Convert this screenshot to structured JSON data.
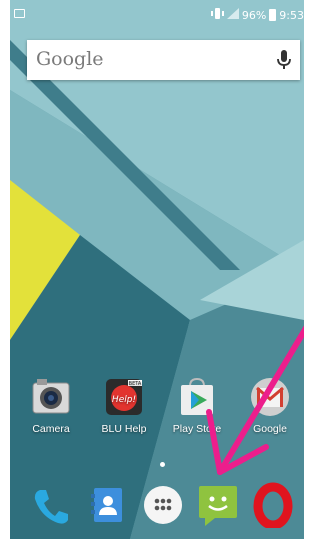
{
  "status_bar": {
    "battery": "96%",
    "time": "9:53",
    "icons": [
      "screenshot-icon",
      "vibrate-icon",
      "signal-icon",
      "battery-icon"
    ]
  },
  "search_widget": {
    "logo_text": "Google",
    "icon": "mic-icon"
  },
  "apps": [
    {
      "label": "Camera",
      "icon": "camera-icon"
    },
    {
      "label": "BLU Help",
      "icon": "blu-help-icon",
      "icon_text": "Help!",
      "badge": "BETA"
    },
    {
      "label": "Play Store",
      "icon": "play-store-icon"
    },
    {
      "label": "Google",
      "icon": "gmail-icon"
    }
  ],
  "dock": [
    {
      "name": "Phone",
      "icon": "phone-icon"
    },
    {
      "name": "Contacts",
      "icon": "contacts-icon"
    },
    {
      "name": "All apps",
      "icon": "app-drawer-icon"
    },
    {
      "name": "Messaging",
      "icon": "messaging-icon"
    },
    {
      "name": "Opera",
      "icon": "opera-icon"
    }
  ],
  "annotation": {
    "color": "#ec1e8c",
    "icon": "arrow-icon"
  },
  "colors": {
    "wallpaper_base": "#5f9ba6",
    "accent_yellow": "#e3e13a"
  }
}
